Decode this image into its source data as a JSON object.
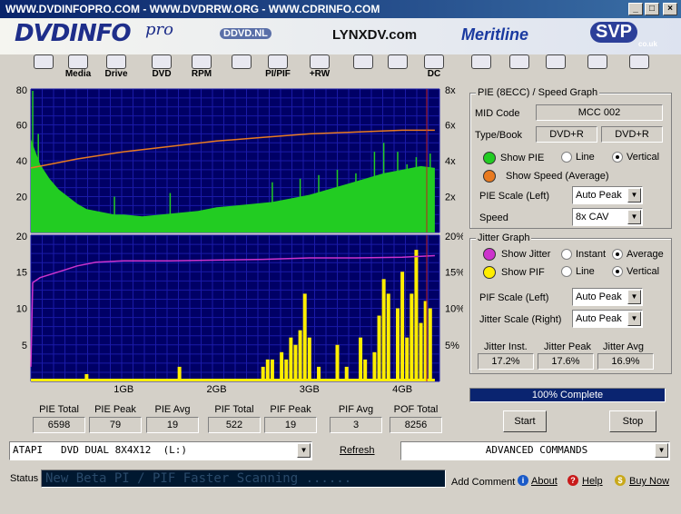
{
  "window": {
    "title": "WWW.DVDINFOPRO.COM  -  WWW.DVDRRW.ORG  -  WWW.CDRINFO.COM",
    "minimize": "_",
    "maximize": "□",
    "close": "×"
  },
  "banner": {
    "logo": "DVDINFO",
    "logo_suffix": "pro",
    "ads": [
      "DDVD.NL",
      "LYNXDV.com",
      "Meritline",
      "SVP"
    ],
    "ad_suffix": "co.uk"
  },
  "toolbar": {
    "items": [
      {
        "label": "",
        "icon": "monitor-icon"
      },
      {
        "label": "Media",
        "icon": "media-disc-icon"
      },
      {
        "label": "Drive",
        "icon": "drive-icon"
      },
      {
        "label": "DVD",
        "icon": "dvd-icon"
      },
      {
        "label": "RPM",
        "icon": "rpm-icon"
      },
      {
        "label": "",
        "icon": "magnifier-icon"
      },
      {
        "label": "PI/PIF",
        "icon": "pi-pif-icon"
      },
      {
        "label": "+RW",
        "icon": "plus-rw-icon"
      },
      {
        "label": "",
        "icon": "eraser-icon"
      },
      {
        "label": "",
        "icon": "burn-icon"
      },
      {
        "label": "DC",
        "icon": "dc-icon"
      },
      {
        "label": "",
        "icon": "notes-icon"
      },
      {
        "label": "",
        "icon": "camera-icon"
      },
      {
        "label": "",
        "icon": "edit-icon"
      },
      {
        "label": "",
        "icon": "pause-icon"
      },
      {
        "label": "",
        "icon": "stop-icon"
      }
    ]
  },
  "pie_panel": {
    "title": "PIE (8ECC) / Speed Graph",
    "mid_code_label": "MID Code",
    "mid_code_value": "MCC    002",
    "type_book_label": "Type/Book",
    "type_value": "DVD+R",
    "book_value": "DVD+R",
    "show_pie_label": "Show PIE",
    "show_speed_label": "Show Speed (Average)",
    "line_label": "Line",
    "vertical_label": "Vertical",
    "pie_scale_label": "PIE Scale (Left)",
    "pie_scale_value": "Auto Peak",
    "speed_label": "Speed",
    "speed_value": "8x CAV",
    "pie_color": "#22cc22",
    "speed_color": "#e87a20"
  },
  "jitter_panel": {
    "title": "Jitter Graph",
    "show_jitter_label": "Show Jitter",
    "instant_label": "Instant",
    "average_label": "Average",
    "show_pif_label": "Show PIF",
    "line_label": "Line",
    "vertical_label": "Vertical",
    "pif_scale_label": "PIF Scale (Left)",
    "pif_scale_value": "Auto Peak",
    "jitter_scale_label": "Jitter Scale (Right)",
    "jitter_scale_value": "Auto Peak",
    "jitter_inst_label": "Jitter Inst.",
    "jitter_inst_value": "17.2%",
    "jitter_peak_label": "Jitter Peak",
    "jitter_peak_value": "17.6%",
    "jitter_avg_label": "Jitter Avg",
    "jitter_avg_value": "16.9%",
    "jitter_color": "#cc33cc",
    "pif_color": "#ffee00"
  },
  "progress": {
    "label": "100% Complete",
    "fraction": 1.0
  },
  "buttons": {
    "start": "Start",
    "stop": "Stop",
    "refresh": "Refresh",
    "add_comment": "Add Comment",
    "about": "About",
    "help": "Help",
    "buy_now": "Buy Now"
  },
  "stats": [
    {
      "label": "PIE Total",
      "value": "6598"
    },
    {
      "label": "PIE Peak",
      "value": "79"
    },
    {
      "label": "PIE Avg",
      "value": "19"
    },
    {
      "label": "PIF Total",
      "value": "522"
    },
    {
      "label": "PIF Peak",
      "value": "19"
    },
    {
      "label": "PIF Avg",
      "value": "3"
    },
    {
      "label": "POF Total",
      "value": "8256"
    }
  ],
  "drive_select": "ATAPI   DVD DUAL 8X4X12  (L:)",
  "advanced_commands": "ADVANCED COMMANDS",
  "status": {
    "label": "Status",
    "text": "New Beta PI / PIF Faster Scanning ......"
  },
  "chart_data": [
    {
      "type": "bar",
      "name_hint": "PIE / Speed",
      "y_left_ticks": [
        "80",
        "60",
        "40",
        "20"
      ],
      "y_right_ticks": [
        "8x",
        "6x",
        "4x",
        "2x"
      ],
      "ylim": [
        0,
        80
      ],
      "y2lim": [
        0,
        8
      ],
      "xlim": [
        0,
        4.4
      ],
      "pie_color": "#22cc22",
      "speed_color": "#e87a20",
      "pie_envelope": [
        [
          0.0,
          52
        ],
        [
          0.05,
          45
        ],
        [
          0.1,
          38
        ],
        [
          0.2,
          30
        ],
        [
          0.3,
          24
        ],
        [
          0.4,
          20
        ],
        [
          0.5,
          16
        ],
        [
          0.6,
          13
        ],
        [
          0.7,
          12
        ],
        [
          0.8,
          11
        ],
        [
          0.9,
          10
        ],
        [
          1.0,
          10
        ],
        [
          1.2,
          9
        ],
        [
          1.4,
          10
        ],
        [
          1.6,
          11
        ],
        [
          1.8,
          12
        ],
        [
          2.0,
          14
        ],
        [
          2.2,
          15
        ],
        [
          2.4,
          16
        ],
        [
          2.6,
          17
        ],
        [
          2.8,
          19
        ],
        [
          3.0,
          21
        ],
        [
          3.2,
          24
        ],
        [
          3.4,
          27
        ],
        [
          3.6,
          30
        ],
        [
          3.8,
          33
        ],
        [
          4.0,
          35
        ],
        [
          4.2,
          37
        ],
        [
          4.35,
          36
        ]
      ],
      "pie_spikes": [
        [
          0.02,
          79
        ],
        [
          0.08,
          55
        ],
        [
          0.9,
          20
        ],
        [
          1.5,
          22
        ],
        [
          2.6,
          28
        ],
        [
          2.9,
          30
        ],
        [
          3.1,
          32
        ],
        [
          3.3,
          35
        ],
        [
          3.5,
          33
        ],
        [
          3.7,
          45
        ],
        [
          3.8,
          50
        ],
        [
          3.95,
          45
        ],
        [
          4.05,
          38
        ],
        [
          4.15,
          42
        ],
        [
          4.3,
          44
        ]
      ],
      "speed": [
        [
          0.0,
          3.6
        ],
        [
          0.2,
          3.8
        ],
        [
          0.5,
          4.1
        ],
        [
          1.0,
          4.5
        ],
        [
          1.5,
          4.8
        ],
        [
          2.0,
          5.1
        ],
        [
          2.5,
          5.3
        ],
        [
          3.0,
          5.5
        ],
        [
          3.5,
          5.6
        ],
        [
          4.0,
          5.7
        ],
        [
          4.35,
          5.7
        ]
      ]
    },
    {
      "type": "bar",
      "name_hint": "PIF / Jitter",
      "y_left_ticks": [
        "20",
        "15",
        "10",
        "5"
      ],
      "y_right_ticks": [
        "20%",
        "15%",
        "10%",
        "5%"
      ],
      "x_ticks": [
        "1GB",
        "2GB",
        "3GB",
        "4GB"
      ],
      "ylim": [
        0,
        20
      ],
      "y2lim": [
        0,
        20
      ],
      "xlim": [
        0,
        4.4
      ],
      "pif_color": "#ffee00",
      "jitter_color": "#cc33cc",
      "pif_bars": [
        [
          0.6,
          1
        ],
        [
          1.6,
          2
        ],
        [
          2.5,
          2
        ],
        [
          2.55,
          3
        ],
        [
          2.6,
          3
        ],
        [
          2.7,
          4
        ],
        [
          2.75,
          3
        ],
        [
          2.8,
          6
        ],
        [
          2.85,
          5
        ],
        [
          2.9,
          7
        ],
        [
          2.95,
          12
        ],
        [
          3.0,
          6
        ],
        [
          3.1,
          2
        ],
        [
          3.3,
          5
        ],
        [
          3.4,
          2
        ],
        [
          3.55,
          6
        ],
        [
          3.6,
          3
        ],
        [
          3.7,
          4
        ],
        [
          3.75,
          9
        ],
        [
          3.8,
          14
        ],
        [
          3.85,
          12
        ],
        [
          3.95,
          10
        ],
        [
          4.0,
          15
        ],
        [
          4.05,
          6
        ],
        [
          4.1,
          12
        ],
        [
          4.15,
          18
        ],
        [
          4.2,
          8
        ],
        [
          4.25,
          11
        ],
        [
          4.3,
          10
        ]
      ],
      "jitter": [
        [
          0.0,
          2
        ],
        [
          0.02,
          13.5
        ],
        [
          0.1,
          14.2
        ],
        [
          0.3,
          15.0
        ],
        [
          0.5,
          15.8
        ],
        [
          0.7,
          16.3
        ],
        [
          1.0,
          16.5
        ],
        [
          1.5,
          16.5
        ],
        [
          2.0,
          16.6
        ],
        [
          2.5,
          16.7
        ],
        [
          3.0,
          16.9
        ],
        [
          3.5,
          16.9
        ],
        [
          4.0,
          17.0
        ],
        [
          4.35,
          17.2
        ]
      ]
    }
  ]
}
